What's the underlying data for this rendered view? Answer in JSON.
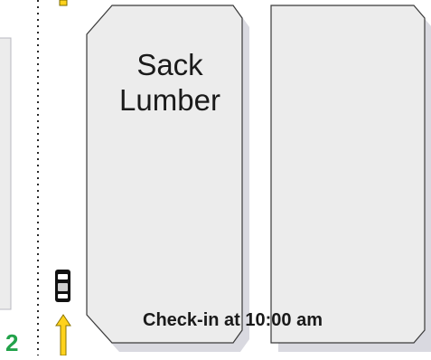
{
  "map": {
    "building_name_line1": "Sack",
    "building_name_line2": "Lumber",
    "checkin_text": "Check-in at 10:00 am",
    "door_number": "2",
    "colors": {
      "building_fill": "#ececec",
      "building_stroke": "#3a3a3a",
      "shadow": "#d9d9e0",
      "arrow": "#ffd21c",
      "number": "#22a24a"
    },
    "icons": [
      "vehicle-icon",
      "arrow-up-icon"
    ]
  }
}
